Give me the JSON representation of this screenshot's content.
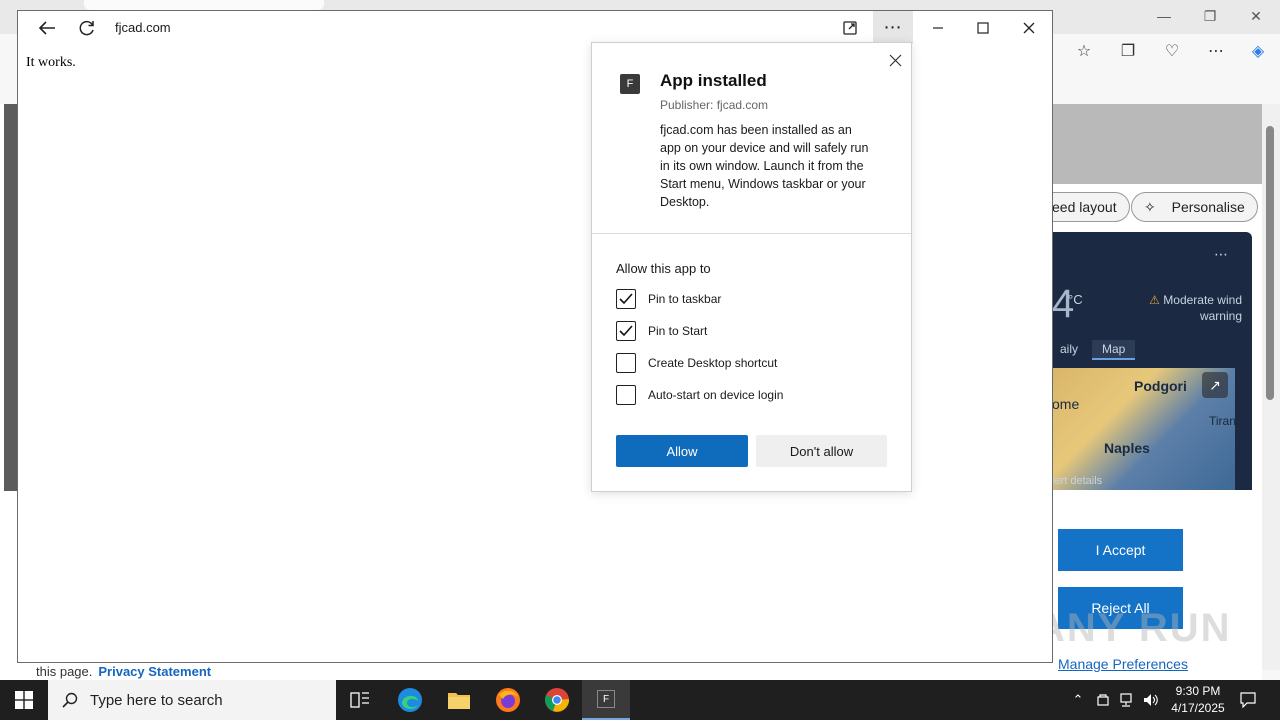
{
  "background_browser": {
    "feed_layout_label": "eed layout",
    "personalise_label": "Personalise",
    "weather": {
      "temp": "4",
      "unit": "°C",
      "warning": "Moderate wind warning",
      "tab_daily": "aily",
      "tab_map": "Map",
      "city_1": "Podgori",
      "city_2": "Naples",
      "city_3": "ome",
      "city_4": "Tiran",
      "alert_details": "lert details"
    },
    "accept_label": "I Accept",
    "reject_label": "Reject All",
    "manage_label": "Manage Preferences",
    "privacy_prefix": "this page.",
    "privacy_link": "Privacy Statement",
    "watermark": "ANY RUN"
  },
  "app_window": {
    "url": "fjcad.com",
    "page_text": "It works."
  },
  "flyout": {
    "icon_letter": "F",
    "title": "App installed",
    "publisher": "Publisher: fjcad.com",
    "description": "fjcad.com has been installed as an app on your device and will safely run in its own window. Launch it from the Start menu, Windows taskbar or your Desktop.",
    "allow_heading": "Allow this app to",
    "options": [
      {
        "label": "Pin to taskbar",
        "checked": true
      },
      {
        "label": "Pin to Start",
        "checked": true
      },
      {
        "label": "Create Desktop shortcut",
        "checked": false
      },
      {
        "label": "Auto-start on device login",
        "checked": false
      }
    ],
    "allow_button": "Allow",
    "deny_button": "Don't allow"
  },
  "taskbar": {
    "search_placeholder": "Type here to search",
    "active_app_letter": "F",
    "time": "9:30 PM",
    "date": "4/17/2025"
  },
  "colors": {
    "accent": "#0f6cbd",
    "taskbar": "#1f1f1f"
  }
}
